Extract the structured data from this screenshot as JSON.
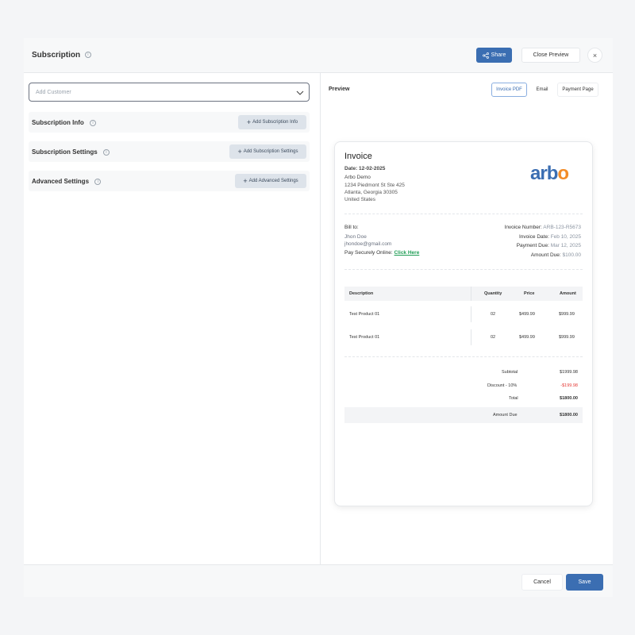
{
  "header": {
    "title": "Subscription",
    "share_label": "Share",
    "close_preview_label": "Close Preview",
    "close_icon": "×"
  },
  "left": {
    "customer_select": {
      "placeholder": "Add Customer"
    },
    "sections": [
      {
        "label": "Subscription Info",
        "button": "Add Subscription Info"
      },
      {
        "label": "Subscription Settings",
        "button": "Add Subscription Settings"
      },
      {
        "label": "Advanced Settings",
        "button": "Add Advanced Settings"
      }
    ]
  },
  "preview": {
    "label": "Preview",
    "tabs": [
      {
        "label": "Invoice PDF",
        "active": true
      },
      {
        "label": "Email",
        "active": false
      },
      {
        "label": "Payment Page",
        "active": false
      }
    ]
  },
  "invoice": {
    "title": "Invoice",
    "date": "Date: 12-02-2025",
    "company": "Arbo Demo",
    "address1": "1234 Piedmont St Ste 425",
    "address2": "Atlanta, Georgia 30305",
    "country": "United States",
    "logo_main": "arb",
    "logo_accent": "o",
    "bill_to_label": "Bill to:",
    "customer_name": "Jhon Doe",
    "customer_email": "jhondoe@gmail.com",
    "pay_online_label": "Pay Securely Online:",
    "pay_online_link": "Click Here",
    "meta": [
      {
        "key": "Invoice Number:",
        "value": "ARB-123-R5673"
      },
      {
        "key": "Invoice Date:",
        "value": "Feb 10, 2025"
      },
      {
        "key": "Payment Due:",
        "value": "Mar 12, 2025"
      },
      {
        "key": "Amount Due:",
        "value": "$100.00"
      }
    ],
    "columns": [
      "Description",
      "Quantity",
      "Price",
      "Amount"
    ],
    "rows": [
      {
        "description": "Test Product 01",
        "quantity": "02",
        "price": "$499.99",
        "amount": "$999.99"
      },
      {
        "description": "Test Product 01",
        "quantity": "02",
        "price": "$499.99",
        "amount": "$999.99"
      }
    ],
    "subtotal_label": "Subtotal",
    "subtotal_value": "$1999.98",
    "discount_label": "Discount - 10%",
    "discount_value": "-$199.98",
    "total_label": "Total",
    "total_value": "$1800.00",
    "amount_due_label": "Amount Due",
    "amount_due_value": "$1800.00",
    "colors": {
      "brand": "#3b6eb2",
      "logo_accent": "#f28c28",
      "discount": "#e53935",
      "link": "#1f9d55"
    }
  },
  "footer": {
    "cancel_label": "Cancel",
    "save_label": "Save"
  }
}
